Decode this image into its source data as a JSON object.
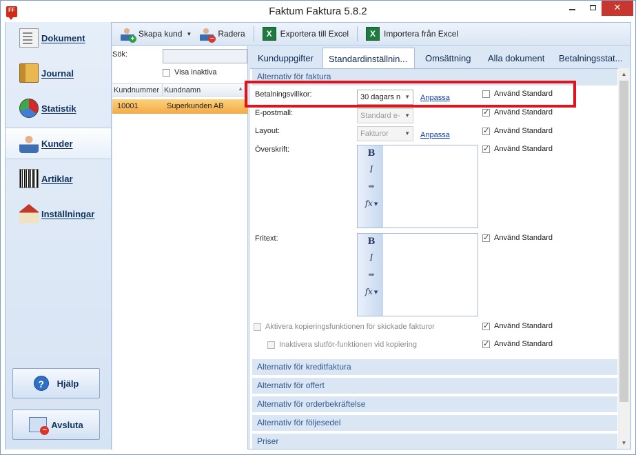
{
  "window": {
    "title": "Faktum Faktura 5.8.2",
    "app_icon_text": "FF",
    "close": "✕"
  },
  "nav": {
    "items": [
      {
        "label": "Dokument",
        "icon": "document-icon",
        "active": false
      },
      {
        "label": "Journal",
        "icon": "journal-icon",
        "active": false
      },
      {
        "label": "Statistik",
        "icon": "statistics-icon",
        "active": false
      },
      {
        "label": "Kunder",
        "icon": "customer-icon",
        "active": true
      },
      {
        "label": "Artiklar",
        "icon": "barcode-icon",
        "active": false
      },
      {
        "label": "Inställningar",
        "icon": "house-settings-icon",
        "active": false
      }
    ],
    "help_label": "Hjälp",
    "help_icon_glyph": "?",
    "exit_label": "Avsluta"
  },
  "toolbar": {
    "create_label": "Skapa kund",
    "delete_label": "Radera",
    "export_label": "Exportera till Excel",
    "import_label": "Importera från Excel",
    "excel_glyph": "X",
    "dropdown_glyph": "▼"
  },
  "list": {
    "search_label": "Sök:",
    "search_value": "",
    "show_inactive_label": "Visa inaktiva",
    "columns": [
      "Kundnummer",
      "Kundnamn"
    ],
    "sort_indicator": "▲",
    "rows": [
      {
        "number": "10001",
        "name": "Superkunden AB",
        "selected": true
      }
    ]
  },
  "tabs": [
    {
      "label": "Kunduppgifter",
      "active": false
    },
    {
      "label": "Standardinställnin...",
      "active": true
    },
    {
      "label": "Omsättning",
      "active": false
    },
    {
      "label": "Alla dokument",
      "active": false
    },
    {
      "label": "Betalningsstat...",
      "active": false
    }
  ],
  "settings": {
    "section_invoice": "Alternativ för faktura",
    "payment_terms_label": "Betalningsvillkor:",
    "payment_terms_value": "30 dagars n",
    "email_label": "E-postmall:",
    "email_value": "Standard e-",
    "layout_label": "Layout:",
    "layout_value": "Fakturor",
    "heading_label": "Överskrift:",
    "freetext_label": "Fritext:",
    "customize_link": "Anpassa",
    "use_default_label": "Använd Standard",
    "copy_function_label": "Aktivera kopieringsfunktionen för skickade fakturor",
    "disable_finalize_label": "Inaktivera slutför-funktionen vid kopiering",
    "editor_bold": "B",
    "editor_italic": "I",
    "editor_indent": "➡",
    "editor_fx": "fx",
    "sections": [
      "Alternativ för kreditfaktura",
      "Alternativ för offert",
      "Alternativ för orderbekräftelse",
      "Alternativ för följesedel",
      "Priser"
    ]
  },
  "colors": {
    "highlight": "#e0141a",
    "selected_row": "#f5a943",
    "section_text": "#30578d"
  }
}
